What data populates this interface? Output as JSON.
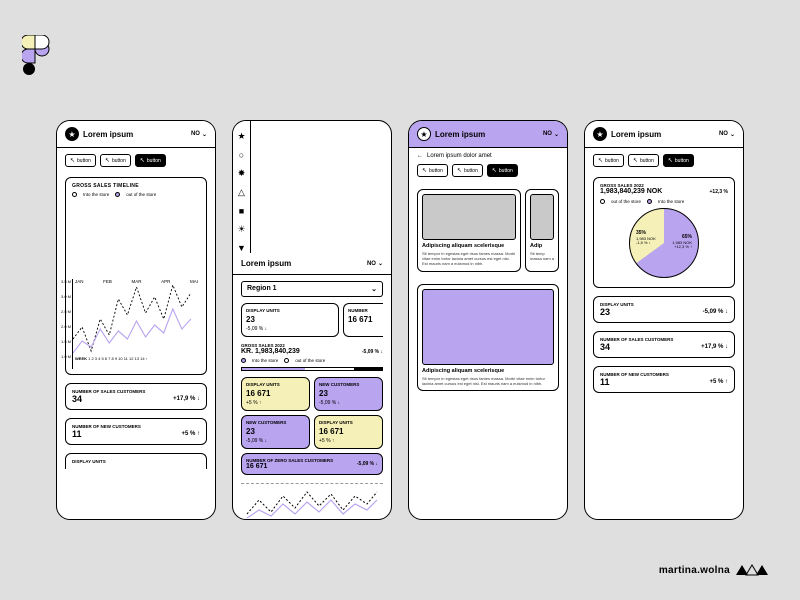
{
  "brand": {
    "title": "Lorem ipsum",
    "lang": "NO"
  },
  "buttons": {
    "b1": "button",
    "b2": "button",
    "b3": "button"
  },
  "screen1": {
    "chart_title": "GROSS SALES TIMELINE",
    "legend_in": "Into the store",
    "legend_out": "out of the store",
    "y": [
      "3.5 M",
      "3.0 M",
      "2.5 M",
      "2.0 M",
      "1.5 M",
      "1.0 M"
    ],
    "week_label": "WEEK",
    "weeks": "1  2  3  4  5  6  7  8  9  10  11  12  13  14",
    "months": [
      "JAN",
      "FEB",
      "MAR",
      "APR",
      "MAI"
    ],
    "row1_label": "NUMBER OF SALES CUSTOMERS",
    "row1_val": "34",
    "row1_delta": "+17,9 % ↓",
    "row2_label": "NUMBER OF NEW CUSTOMERS",
    "row2_val": "11",
    "row2_delta": "+5 % ↑",
    "row3_label": "DISPLAY UNITS"
  },
  "screen2": {
    "region": "Region 1",
    "tile1_label": "DISPLAY UNITS",
    "tile1_val": "23",
    "tile1_delta": "-5,09 % ↓",
    "tile2_label": "NUMBER",
    "tile2_val": "16 671",
    "gross_label": "GROSS SALES 2022",
    "gross_val": "KR. 1,983,840,239",
    "gross_delta": "-5,09 % ↓",
    "a_label": "DISPLAY UNITS",
    "a_val": "16 671",
    "a_delta": "+5 % ↑",
    "b_label": "NEW CUSTOMERS",
    "b_val": "23",
    "b_delta": "-5,09 % ↓",
    "c_label": "NEW CUSTOMERS",
    "c_val": "23",
    "c_delta": "-5,09 % ↓",
    "d_label": "DISPLAY UNITS",
    "d_val": "16 671",
    "d_delta": "+5 % ↑",
    "e_label": "NUMBER OF ZERO SALES CUSTOMERS",
    "e_val": "16 671",
    "e_delta": "-5,09 % ↓"
  },
  "screen3": {
    "back": "Lorem ipsum dolor amet",
    "card1_t": "Adipiscing aliquam scelerisque",
    "card1_d": "Sit tempor in egestas eget risus fames massa. Morbi vitae enim tortor lacinia amet cursus est eget nisl. Est mauris nam a euismod in nibh.",
    "card1b_t": "Adip",
    "card1b_d": "Sit temp massa nam a",
    "card2_t": "Adipiscing aliquam scelerisque",
    "card2_d": "Sit tempor in egestas eget risus fames massa. Morbi vitae enim tortor lacinia amet cursus est eget nisl. Est mauris nam a euismod in nibh."
  },
  "screen4": {
    "gross_label": "GROSS SALES 2022",
    "gross_val": "1,983,840,239 NOK",
    "gross_delta": "+12,3 %",
    "legend_out": "out of the store",
    "legend_in": "Into the store",
    "pie_l_pct": "35%",
    "pie_l_amt": "1,983 NOK",
    "pie_l_d": "-1,5 % ↓",
    "pie_r_pct": "65%",
    "pie_r_amt": "1,983 NOK",
    "pie_r_d": "+12,3 % ↑",
    "r1_label": "DISPLAY UNITS",
    "r1_val": "23",
    "r1_delta": "-5,09 % ↓",
    "r2_label": "NUMBER OF SALES CUSTOMERS",
    "r2_val": "34",
    "r2_delta": "+17,9 % ↓",
    "r3_label": "NUMBER OF NEW CUSTOMERS",
    "r3_val": "11",
    "r3_delta": "+5 % ↑"
  },
  "credit": "martina.wolna",
  "chart_data": [
    {
      "type": "line",
      "title": "GROSS SALES TIMELINE",
      "ylim": [
        1.0,
        3.5
      ],
      "y_unit": "M",
      "x_weeks": [
        1,
        2,
        3,
        4,
        5,
        6,
        7,
        8,
        9,
        10,
        11,
        12,
        13,
        14
      ],
      "x_months": [
        "JAN",
        "FEB",
        "MAR",
        "APR",
        "MAI"
      ],
      "series": [
        {
          "name": "Into the store",
          "values": [
            1.6,
            2.0,
            1.2,
            2.3,
            1.7,
            2.8,
            2.3,
            3.2,
            2.4,
            2.9,
            2.2,
            3.3,
            2.6,
            3.1
          ]
        },
        {
          "name": "out of the store",
          "values": [
            1.1,
            1.5,
            1.3,
            1.9,
            1.4,
            1.8,
            1.5,
            2.1,
            1.6,
            2.0,
            1.7,
            2.4,
            1.8,
            2.2
          ]
        }
      ]
    },
    {
      "type": "pie",
      "title": "GROSS SALES 2022",
      "series": [
        {
          "name": "Into the store",
          "value": 65,
          "amount": "1,983 NOK",
          "delta": "+12,3 %"
        },
        {
          "name": "out of the store",
          "value": 35,
          "amount": "1,983 NOK",
          "delta": "-1,5 %"
        }
      ]
    }
  ]
}
